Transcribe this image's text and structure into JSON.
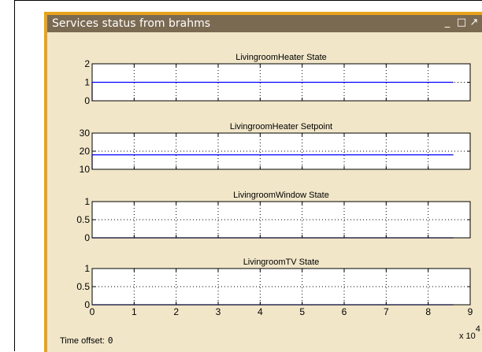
{
  "window": {
    "title": "Services status from brahms",
    "minimize_glyph": "_",
    "maximize_glyph": "□",
    "restore_glyph": "↗",
    "close_glyph": "✕",
    "frame_color": "#e8a31b",
    "titlebar_color": "#7b6a52",
    "background_color": "#f1e6c8"
  },
  "footer": {
    "time_offset_label": "Time offset:",
    "time_offset_value": "0",
    "x_scale_base": "x 10",
    "x_scale_exponent": "4"
  },
  "chart_data": [
    {
      "type": "line",
      "title": "LivingroomHeater State",
      "xlim": [
        0,
        9
      ],
      "x_ticks": [
        "0",
        "1",
        "2",
        "3",
        "4",
        "5",
        "6",
        "7",
        "8",
        "9"
      ],
      "ylim": [
        0,
        2
      ],
      "y_ticks": [
        "0",
        "1",
        "2"
      ],
      "grid": true,
      "series": [
        {
          "color": "#0000ff",
          "x": [
            0,
            8.6
          ],
          "y": [
            1,
            1
          ]
        }
      ]
    },
    {
      "type": "line",
      "title": "LivingroomHeater Setpoint",
      "xlim": [
        0,
        9
      ],
      "x_ticks": [
        "0",
        "1",
        "2",
        "3",
        "4",
        "5",
        "6",
        "7",
        "8",
        "9"
      ],
      "ylim": [
        10,
        30
      ],
      "y_ticks": [
        "10",
        "20",
        "30"
      ],
      "grid": true,
      "series": [
        {
          "color": "#0000ff",
          "x": [
            0,
            8.6
          ],
          "y": [
            18,
            18
          ]
        }
      ]
    },
    {
      "type": "line",
      "title": "LivingroomWindow State",
      "xlim": [
        0,
        9
      ],
      "x_ticks": [
        "0",
        "1",
        "2",
        "3",
        "4",
        "5",
        "6",
        "7",
        "8",
        "9"
      ],
      "ylim": [
        0,
        1
      ],
      "y_ticks": [
        "0",
        "0.5",
        "1"
      ],
      "grid": true,
      "series": [
        {
          "color": "#0000ff",
          "x": [
            0,
            8.6
          ],
          "y": [
            0,
            0
          ]
        }
      ]
    },
    {
      "type": "line",
      "title": "LivingroomTV State",
      "xlim": [
        0,
        9
      ],
      "x_ticks": [
        "0",
        "1",
        "2",
        "3",
        "4",
        "5",
        "6",
        "7",
        "8",
        "9"
      ],
      "ylim": [
        0,
        1
      ],
      "y_ticks": [
        "0",
        "0.5",
        "1"
      ],
      "grid": true,
      "show_x_tick_labels": true,
      "series": [
        {
          "color": "#0000ff",
          "x": [
            0,
            8.6
          ],
          "y": [
            0,
            0
          ]
        }
      ]
    }
  ]
}
